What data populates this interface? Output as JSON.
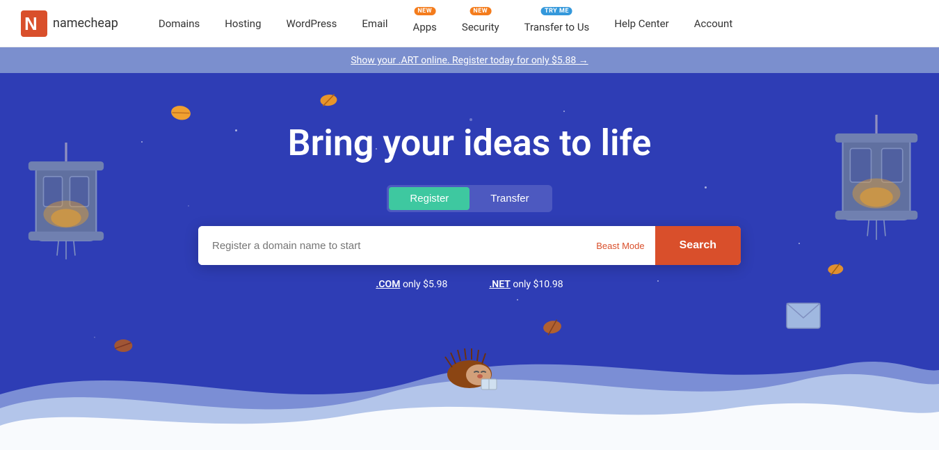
{
  "logo": {
    "text": "namecheap"
  },
  "nav": {
    "links": [
      {
        "label": "Domains",
        "badge": null
      },
      {
        "label": "Hosting",
        "badge": null
      },
      {
        "label": "WordPress",
        "badge": null
      },
      {
        "label": "Email",
        "badge": null
      },
      {
        "label": "Apps",
        "badge": "NEW"
      },
      {
        "label": "Security",
        "badge": "NEW"
      },
      {
        "label": "Transfer to Us",
        "badge": "TRY ME"
      },
      {
        "label": "Help Center",
        "badge": null
      },
      {
        "label": "Account",
        "badge": null
      }
    ]
  },
  "promo": {
    "text": "Show your .ART online. Register today for only $5.88 →"
  },
  "hero": {
    "title": "Bring your ideas to life",
    "tab_register": "Register",
    "tab_transfer": "Transfer",
    "search_placeholder": "Register a domain name to start",
    "beast_mode": "Beast Mode",
    "search_button": "Search",
    "pricing": [
      {
        "tld": ".COM",
        "price": "only $5.98"
      },
      {
        "tld": ".NET",
        "price": "only $10.98"
      }
    ]
  }
}
